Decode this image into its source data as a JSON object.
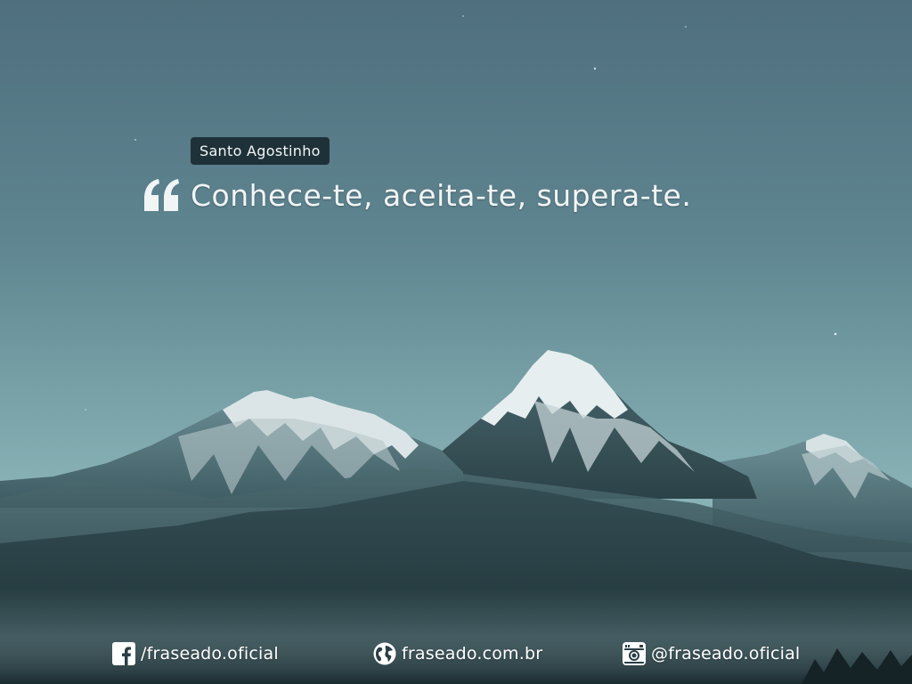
{
  "quote": {
    "author": "Santo Agostinho",
    "text": "Conhece-te, aceita-te, supera-te."
  },
  "footer": {
    "facebook": "/fraseado.oficial",
    "website": "fraseado.com.br",
    "instagram": "@fraseado.oficial"
  },
  "icons": [
    "quote-mark-icon",
    "facebook-icon",
    "globe-icon",
    "instagram-icon"
  ],
  "colors": {
    "sky_top": "#4f6f7e",
    "sky_bottom": "#86b0b4",
    "tag_background": "#1f3138",
    "text": "#f1f5f6"
  }
}
